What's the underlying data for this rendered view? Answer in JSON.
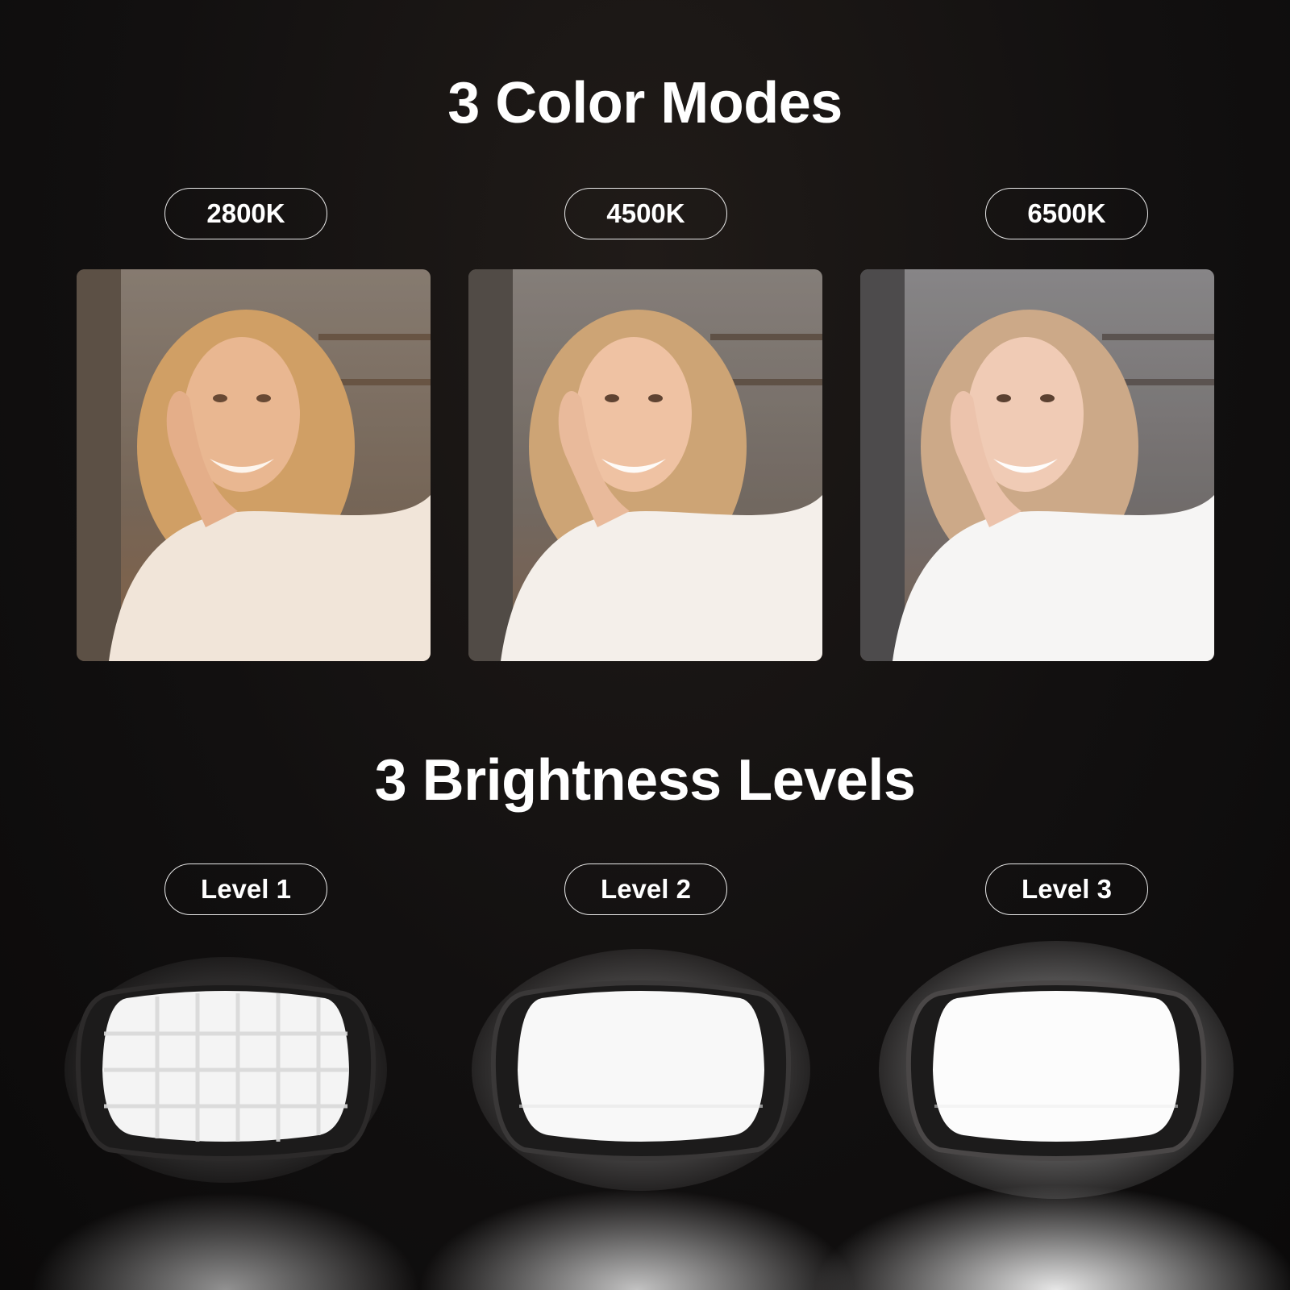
{
  "color_section": {
    "title": "3 Color Modes",
    "modes": [
      {
        "label": "2800K",
        "tint": "#f2c79a"
      },
      {
        "label": "4500K",
        "tint": "#f4dcc6"
      },
      {
        "label": "6500K",
        "tint": "#f3ece6"
      }
    ]
  },
  "brightness_section": {
    "title": "3 Brightness Levels",
    "levels": [
      {
        "label": "Level 1",
        "intensity": 0.55
      },
      {
        "label": "Level 2",
        "intensity": 0.78
      },
      {
        "label": "Level 3",
        "intensity": 1.0
      }
    ]
  },
  "colors": {
    "background": "#121010",
    "text": "#ffffff",
    "pill_border": "#e9e9e9",
    "lamp_housing": "#1c1b1b",
    "lamp_panel": "#f6f6f6"
  }
}
